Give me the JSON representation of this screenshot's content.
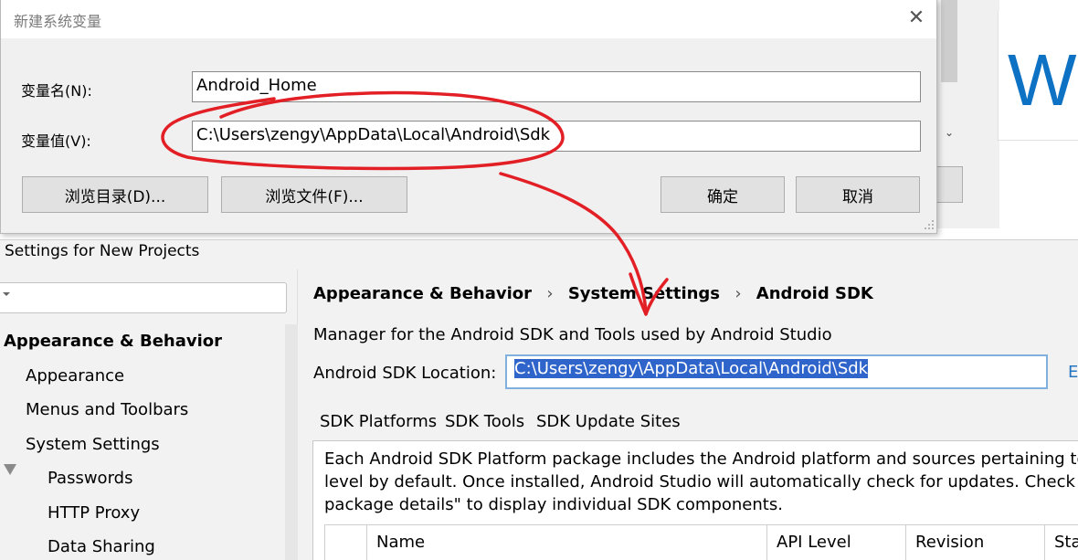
{
  "background": {
    "welcome_text": "Wi",
    "scroll_arrow": "⌄"
  },
  "env_dialog": {
    "title": "新建系统变量",
    "close_glyph": "✕",
    "name_label": "变量名(N):",
    "name_value": "Android_Home",
    "value_label": "变量值(V):",
    "value_value": "C:\\Users\\zengy\\AppData\\Local\\Android\\Sdk",
    "buttons": {
      "browse_dir": "浏览目录(D)...",
      "browse_file": "浏览文件(F)...",
      "ok": "确定",
      "cancel": "取消"
    }
  },
  "settings": {
    "title": "Settings for New Projects",
    "sidebar": {
      "items": [
        {
          "label": "Appearance & Behavior"
        },
        {
          "label": "Appearance"
        },
        {
          "label": "Menus and Toolbars"
        },
        {
          "label": "System Settings"
        },
        {
          "label": "Passwords"
        },
        {
          "label": "HTTP Proxy"
        },
        {
          "label": "Data Sharing"
        }
      ]
    },
    "breadcrumb": {
      "part1": "Appearance & Behavior",
      "part2": "System Settings",
      "part3": "Android SDK",
      "separator": "›"
    },
    "description": "Manager for the Android SDK and Tools used by Android Studio",
    "sdk_location_label": "Android SDK Location:",
    "sdk_location_value": "C:\\Users\\zengy\\AppData\\Local\\Android\\Sdk",
    "sdk_location_edit": "E",
    "tabs": [
      {
        "label": "SDK Platforms"
      },
      {
        "label": "SDK Tools"
      },
      {
        "label": "SDK Update Sites"
      }
    ],
    "panel_text": {
      "line1": "Each Android SDK Platform package includes the Android platform and sources pertaining to ar",
      "line2": "level by default. Once installed, Android Studio will automatically check for updates. Check \"sho",
      "line3": "package details\" to display individual SDK components."
    },
    "table_headers": {
      "name": "Name",
      "api_level": "API Level",
      "revision": "Revision",
      "status": "Sta"
    }
  },
  "colors": {
    "annotation_red": "#e31f26",
    "selection_blue": "#2f65ca",
    "link_blue": "#2675bf"
  }
}
